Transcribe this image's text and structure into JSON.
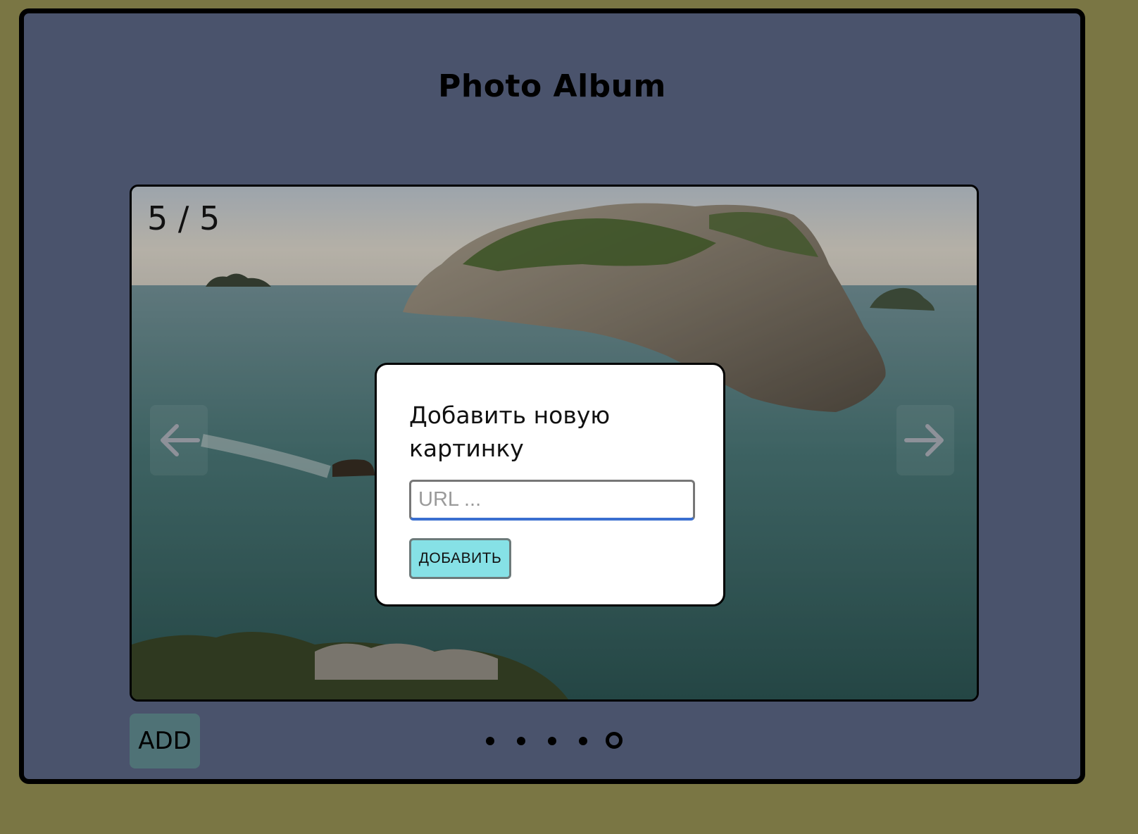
{
  "app": {
    "title": "Photo Album"
  },
  "viewer": {
    "counter": "5 / 5",
    "current_index": 5,
    "total": 5,
    "prev_icon": "arrow-left-icon",
    "next_icon": "arrow-right-icon"
  },
  "modal": {
    "title": "Добавить новую картинку",
    "url_placeholder": "URL ...",
    "url_value": "",
    "submit_label": "ДОБАВИТЬ"
  },
  "footer": {
    "add_label": "ADD",
    "dots": [
      {
        "active": false
      },
      {
        "active": false
      },
      {
        "active": false
      },
      {
        "active": false
      },
      {
        "active": true
      }
    ]
  },
  "colors": {
    "page_background": "#7a7644",
    "frame_background": "#4a536c",
    "add_button": "#4f7276",
    "submit_button": "#86e1e6",
    "input_focus": "#3a6fd0"
  }
}
